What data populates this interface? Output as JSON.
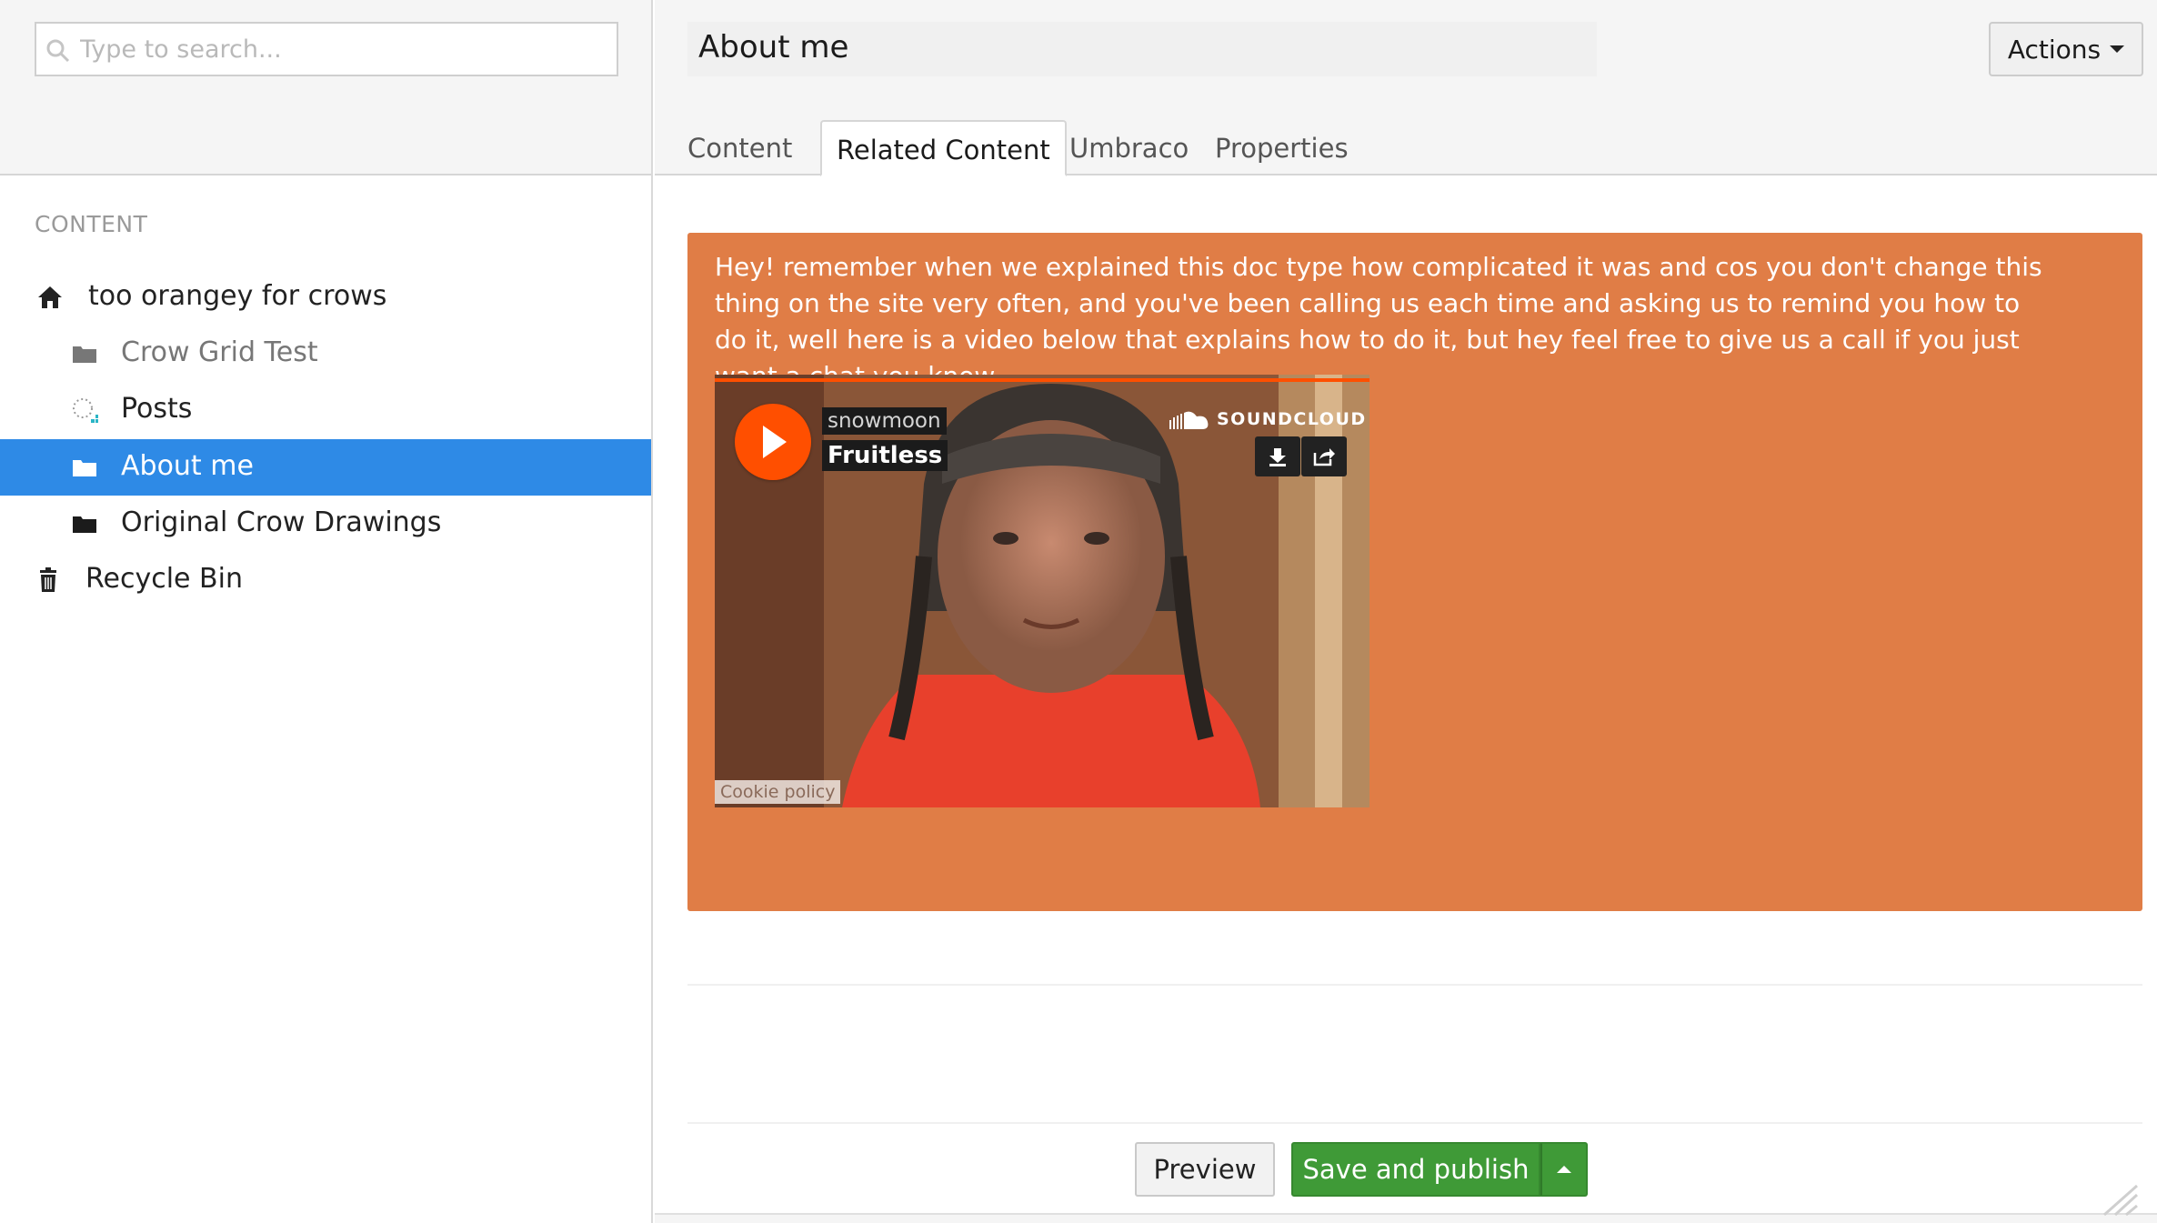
{
  "search": {
    "placeholder": "Type to search..."
  },
  "sidebar": {
    "section_title": "CONTENT",
    "items": [
      {
        "label": "too orangey for crows",
        "icon": "home-icon"
      },
      {
        "label": "Crow Grid Test",
        "icon": "folder-icon"
      },
      {
        "label": "Posts",
        "icon": "loading-dots-icon"
      },
      {
        "label": "About me",
        "icon": "folder-icon",
        "selected": true
      },
      {
        "label": "Original Crow Drawings",
        "icon": "folder-icon"
      },
      {
        "label": "Recycle Bin",
        "icon": "trash-icon"
      }
    ]
  },
  "header": {
    "name": "About me",
    "actions_label": "Actions",
    "tabs": [
      {
        "label": "Content"
      },
      {
        "label": "Related Content",
        "active": true
      },
      {
        "label": "Umbraco"
      },
      {
        "label": "Properties"
      }
    ]
  },
  "notice": {
    "text": "Hey! remember when we explained this doc type how complicated it was and cos you don't change this thing on the site very often, and you've been calling us each time and asking us to remind you how to do it, well here is a video below that explains how to do it, but hey feel free to give us a call if you just want a chat you know...",
    "background": "#e07d46"
  },
  "soundcloud": {
    "user": "snowmoon",
    "track": "Fruitless",
    "brand": "SOUNDCLOUD",
    "cookie": "Cookie policy",
    "accent": "#ff4f00"
  },
  "footer": {
    "preview_label": "Preview",
    "save_label": "Save and publish"
  },
  "colors": {
    "selected": "#2e8ae6",
    "publish": "#3f9a37"
  }
}
